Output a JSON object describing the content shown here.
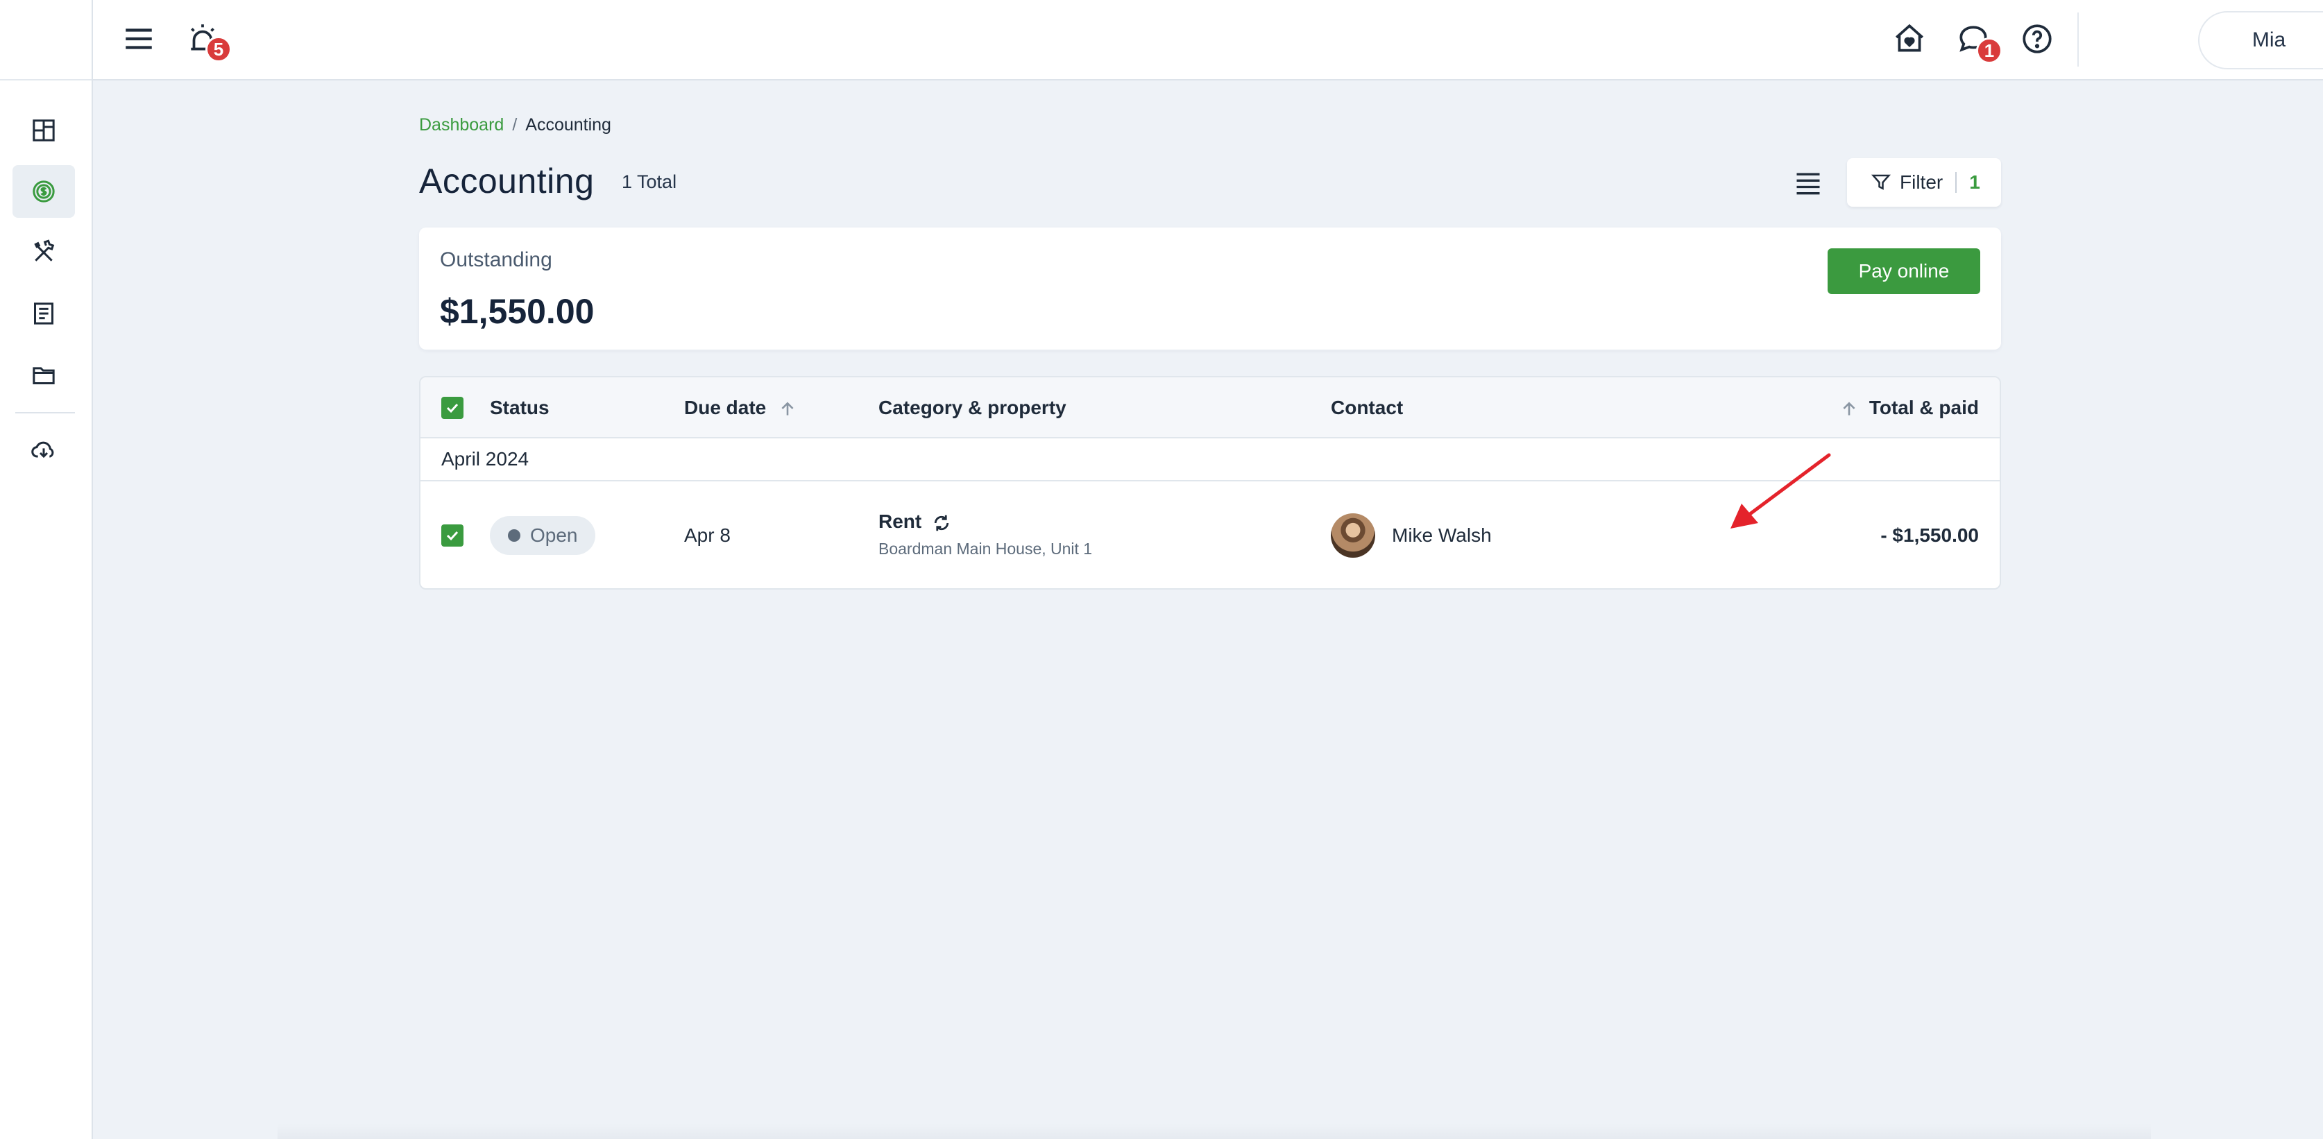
{
  "topbar": {
    "notifications_count": "5",
    "messages_count": "1",
    "user_name": "Mia"
  },
  "breadcrumb": {
    "root": "Dashboard",
    "separator": "/",
    "current": "Accounting"
  },
  "page": {
    "title": "Accounting",
    "total_label": "1 Total"
  },
  "filter": {
    "label": "Filter",
    "count": "1"
  },
  "outstanding": {
    "label": "Outstanding",
    "amount": "$1,550.00",
    "pay_button": "Pay online"
  },
  "table": {
    "columns": {
      "status": "Status",
      "due_date": "Due date",
      "category": "Category & property",
      "contact": "Contact",
      "total": "Total & paid"
    },
    "groups": [
      {
        "label": "April 2024",
        "rows": [
          {
            "status": "Open",
            "due_date": "Apr 8",
            "category": "Rent",
            "property": "Boardman Main House, Unit 1",
            "contact": "Mike Walsh",
            "total": "- $1,550.00"
          }
        ]
      }
    ]
  },
  "colors": {
    "accent_green": "#3a9b3f",
    "badge_red": "#d93b3b",
    "annotation_arrow": "#e4232b"
  },
  "icons": {
    "sidebar": [
      "dashboard-icon",
      "dollar-icon",
      "tools-icon",
      "document-icon",
      "folder-icon",
      "cloud-download-icon"
    ],
    "topbar": [
      "menu-icon",
      "alarm-icon",
      "home-heart-icon",
      "chat-icon",
      "help-icon"
    ]
  }
}
